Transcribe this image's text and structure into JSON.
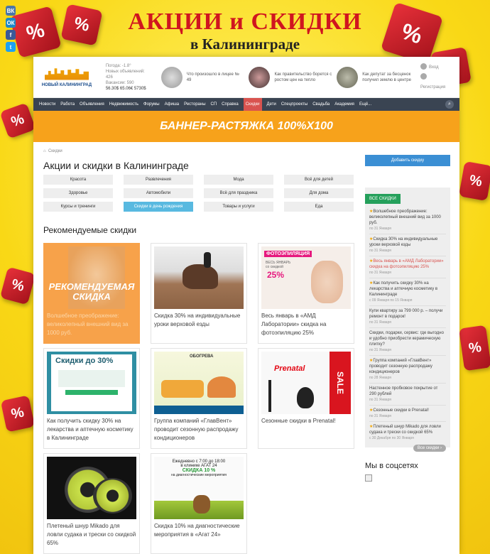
{
  "banner": {
    "title": "АКЦИИ и СКИДКИ",
    "subtitle": "в Калининграде"
  },
  "social": [
    "ВК",
    "ОК",
    "f",
    "t"
  ],
  "header": {
    "logo_text": "НОВЫЙ КАЛИНИНГРАД",
    "weather": [
      "Погода: -1.8°",
      "Новых объявлений:",
      "426",
      "Вакансии: 590",
      "56.30$ 65.06€ 5730$"
    ],
    "news": [
      {
        "text": "Что произошло в лицее № 49"
      },
      {
        "text": "Как правительство борется с ростом цен на тепло"
      },
      {
        "text": "Как депутат за бесценок получил землю в центре"
      }
    ],
    "login": "Вход",
    "register": "Регистрация"
  },
  "nav": {
    "items": [
      "Новости",
      "Работа",
      "Объявления",
      "Недвижимость",
      "Форумы",
      "Афиша",
      "Рестораны",
      "СП",
      "Справка",
      "Скидки",
      "Дети",
      "Спецпроекты",
      "Свадьба",
      "Академия",
      "Ещё..."
    ],
    "active": "Скидки"
  },
  "stretch": "БАННЕР-РАСТЯЖКА 100%X100",
  "breadcrumb": "Скидки",
  "page_title": "Акции и скидки в Калининграде",
  "categories": [
    "Красота",
    "Развлечения",
    "Мода",
    "Всё для детей",
    "Здоровье",
    "Автомобили",
    "Всё для праздника",
    "Для дома",
    "Курсы и тренинги",
    "Скидки в день рождения",
    "Товары и услуги",
    "Еда"
  ],
  "active_category": "Скидки в день рождения",
  "recommended_title": "Рекомендуемые скидки",
  "featured_label": "РЕКОМЕНДУЕМАЯ СКИДКА",
  "cards": [
    {
      "caption": "Волшебное преображение: великолепный внешний вид за 1000 руб."
    },
    {
      "caption": "Скидка 30% на индивидуальные уроки верховой езды"
    },
    {
      "caption": "Весь январь в «АМД Лаборатории» скидка на фотоэпиляцию 25%",
      "img_text": "ФОТОЭПИЛЯЦИЯ",
      "img_sub": "ВЕСЬ ЯНВАРЬ со скидкой",
      "img_pct": "25%"
    },
    {
      "caption": "Как получить скидку 30% на лекарства и аптечную косметику в Калининграде",
      "img_text": "Скидки до 30%"
    },
    {
      "caption": "Группа компаний «ГлавВент» проводит сезонную распродажу кондиционеров",
      "img_text": "ОБОГРЕВА"
    },
    {
      "caption": "Сезонные скидки в Prenatal!",
      "img_text": "Prenatal",
      "img_sale": "SALE"
    },
    {
      "caption": "Плетеный шнур Mikado для ловли судака и трески со скидкой 65%"
    },
    {
      "caption": "Скидка 10% на диагностические мероприятия в «Агат 24»",
      "img_line1": "Ежедневно с 7:00 до 18:00",
      "img_line2": "в клинике АГАТ 24",
      "img_line3": "СКИДКА 10 %",
      "img_line4": "на диагностические мероприятия"
    }
  ],
  "sidebar": {
    "add_button": "Добавить скидку",
    "all_tag": "ВСЕ СКИДКИ",
    "items": [
      {
        "text": "Волшебное преображение: великолепный внешний вид за 1000 руб.",
        "date": "по 31 Января",
        "star": true
      },
      {
        "text": "Скидка 30% на индивидуальные уроки верховой езды",
        "date": "по 31 Января",
        "star": true
      },
      {
        "text": "Весь январь в «АМД Лаборатории» скидка на фотоэпиляцию 25%",
        "date": "по 31 Января",
        "star": true
      },
      {
        "text": "Как получить скидку 30% на лекарства и аптечную косметику в Калининграде",
        "date": "с 09 Января по 15 Января",
        "star": true
      },
      {
        "text": "Купи квартиру за 799 000 р. – получи ремонт в подарок!",
        "date": "по 31 Января",
        "star": false
      },
      {
        "text": "Скидки, подарки, сервис: где выгодно и удобно приобрести керамическую плитку?",
        "date": "по 31 Января",
        "star": false
      },
      {
        "text": "Группа компаний «ГлавВент» проводит сезонную распродажу кондиционеров",
        "date": "по 28 Января",
        "star": true
      },
      {
        "text": "Настенное пробковое покрытие от 290 рублей",
        "date": "по 31 Января",
        "star": false
      },
      {
        "text": "Сезонные скидки в Prenatal!",
        "date": "по 31 Января",
        "star": true
      },
      {
        "text": "Плетеный шнур Mikado для ловли судака и трески со скидкой 65%",
        "date": "с 30 Декабря по 30 Января",
        "star": true
      }
    ],
    "all_button": "Все скидки",
    "social_title": "Мы в соцсетях"
  },
  "colors": {
    "accent_red": "#d0151f",
    "nav_bg": "#3a4452",
    "orange": "#f7a21b",
    "green": "#25a05b",
    "blue": "#3b8fd4"
  }
}
